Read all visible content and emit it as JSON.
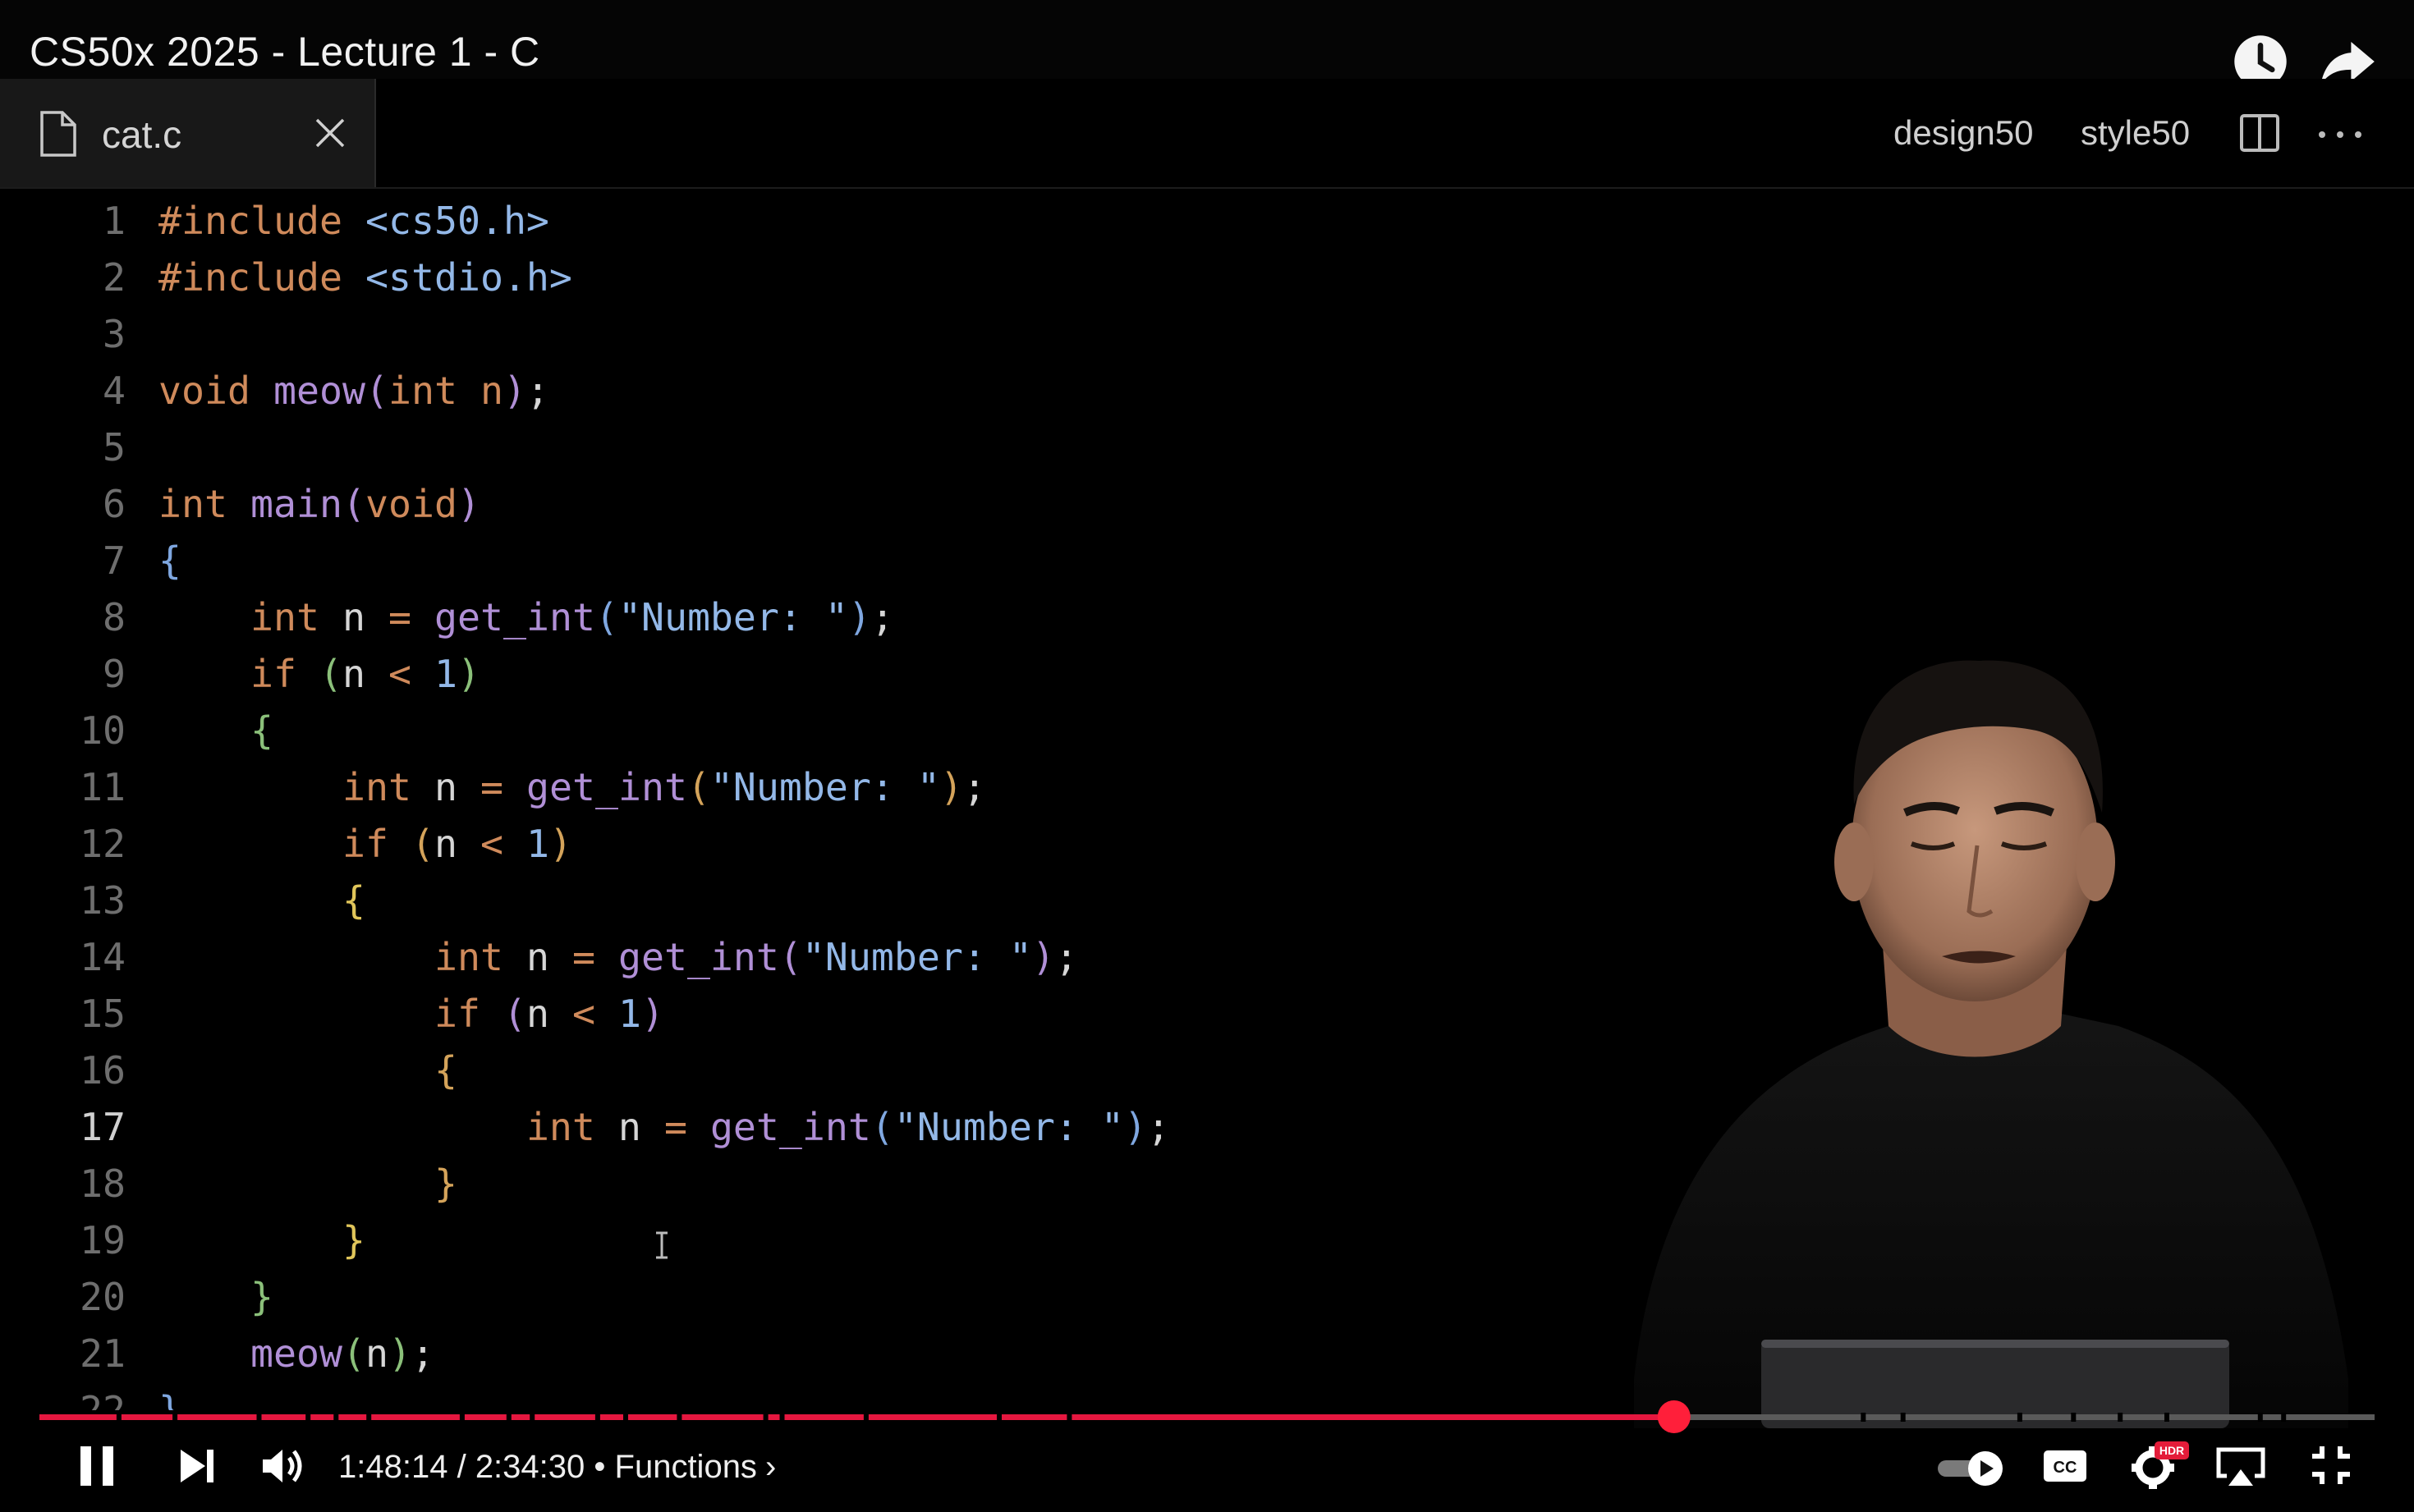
{
  "video": {
    "title": "CS50x 2025 - Lecture 1 - C",
    "current_time": "1:48:14",
    "duration": "2:34:30",
    "chapter": "Functions",
    "progress_fraction": 0.7,
    "chapter_separator": " • ",
    "time_separator": " / ",
    "chapter_chevron": "›",
    "hdr_badge": "HDR",
    "cc_label": "CC"
  },
  "editor": {
    "tab_label": "cat.c",
    "extensions": [
      "design50",
      "style50"
    ],
    "active_line": 17,
    "code_lines": [
      "#include <cs50.h>",
      "#include <stdio.h>",
      "",
      "void meow(int n);",
      "",
      "int main(void)",
      "{",
      "    int n = get_int(\"Number: \");",
      "    if (n < 1)",
      "    {",
      "        int n = get_int(\"Number: \");",
      "        if (n < 1)",
      "        {",
      "            int n = get_int(\"Number: \");",
      "            if (n < 1)",
      "            {",
      "                int n = get_int(\"Number: \");",
      "            }",
      "        }",
      "    }",
      "    meow(n);",
      "}"
    ]
  },
  "icons": {
    "watch_later": "clock-icon",
    "share": "share-arrow-icon",
    "pause": "pause-icon",
    "next": "next-icon",
    "volume": "volume-icon",
    "autoplay": "autoplay-toggle-icon",
    "captions": "captions-icon",
    "settings": "settings-gear-icon",
    "airplay": "airplay-icon",
    "exit_fullscreen": "exit-fullscreen-icon"
  },
  "colors": {
    "progress_played": "#e5173f",
    "progress_unplayed": "#5a5a5a",
    "scrubber": "#ff1f3a",
    "keyword": "#cf8a5b",
    "function": "#b08fd6",
    "string": "#93b8e8"
  }
}
